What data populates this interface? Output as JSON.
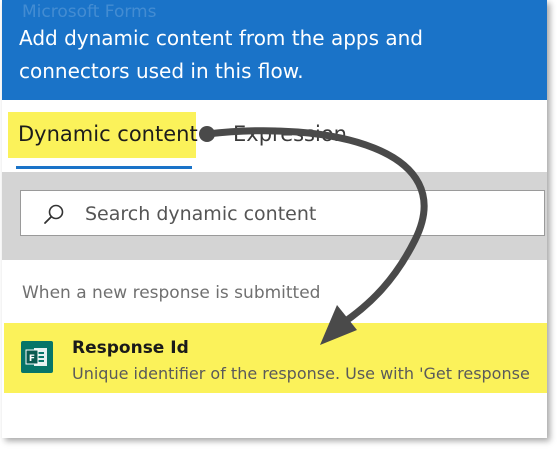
{
  "header": {
    "ghost_title": "Microsoft Forms",
    "message": "Add dynamic content from the apps and connectors used in this flow."
  },
  "tabs": [
    {
      "label": "Dynamic content",
      "selected": true
    },
    {
      "label": "Expression",
      "selected": false
    }
  ],
  "search": {
    "placeholder": "Search dynamic content"
  },
  "section": {
    "label": "When a new response is submitted"
  },
  "items": [
    {
      "title": "Response Id",
      "description": "Unique identifier of the response. Use with 'Get response",
      "icon": "microsoft-forms-icon"
    }
  ],
  "colors": {
    "header_bg": "#1a73c8",
    "highlight": "#fbf25a",
    "tab_underline": "#1a73c8",
    "forms_icon": "#077568",
    "arrow": "#4a4a4a"
  }
}
